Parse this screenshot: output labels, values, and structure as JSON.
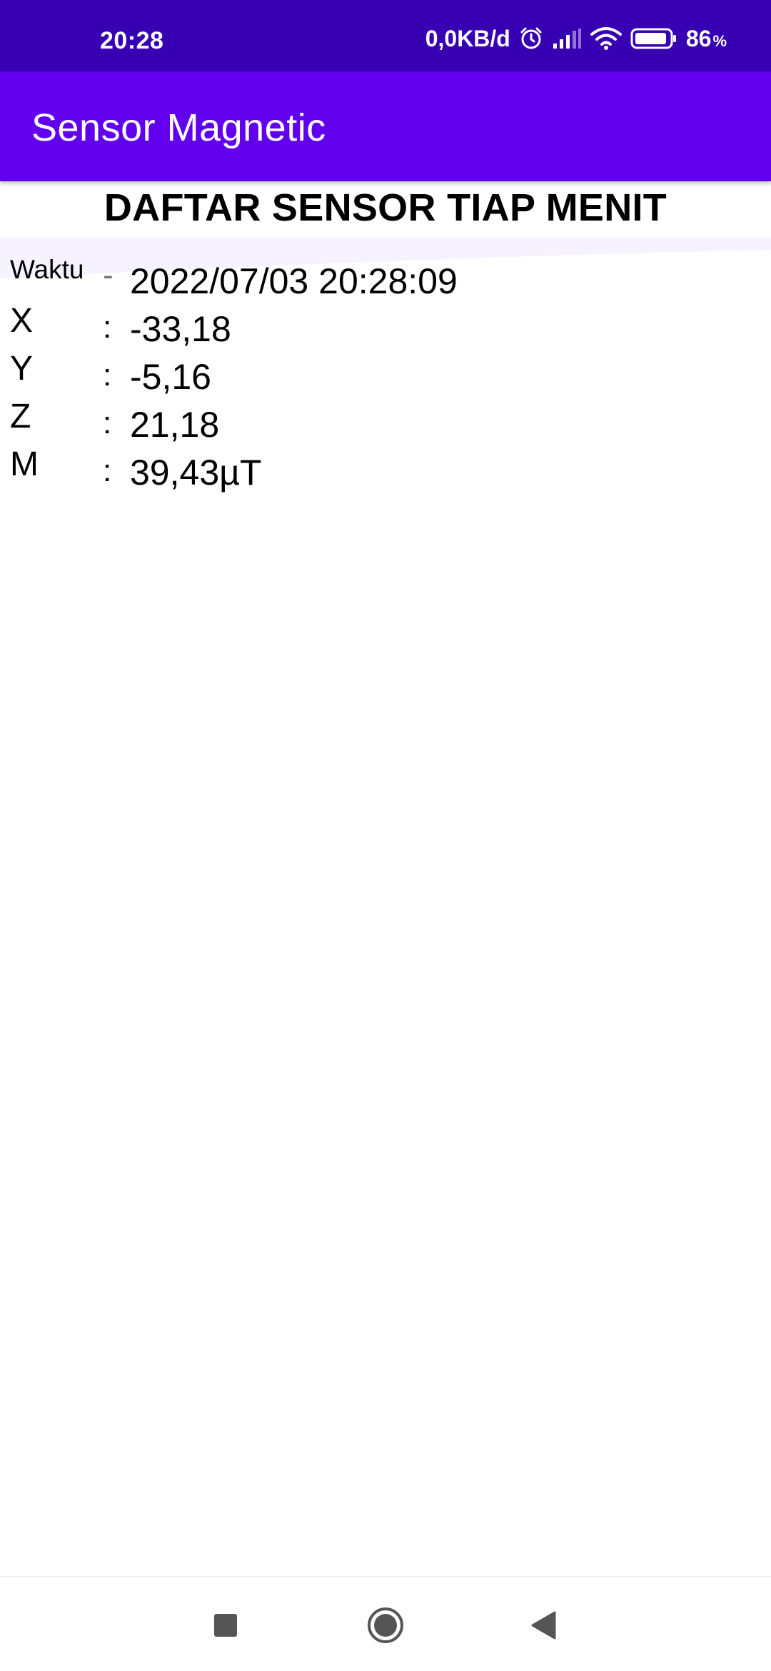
{
  "status_bar": {
    "time": "20:28",
    "network_speed": "0,0KB/d",
    "battery_percent": "86",
    "battery_suffix": "%",
    "icons": [
      "alarm-icon",
      "signal-icon",
      "wifi-icon",
      "battery-icon"
    ]
  },
  "app_bar": {
    "title": "Sensor Magnetic",
    "color": "#6200ee",
    "status_color": "#3700b3"
  },
  "content": {
    "heading": "DAFTAR SENSOR TIAP MENIT",
    "rows": [
      {
        "label": "Waktu",
        "separator": "-",
        "value": "2022/07/03 20:28:09"
      },
      {
        "label": "X",
        "separator": ":",
        "value": "-33,18"
      },
      {
        "label": "Y",
        "separator": ":",
        "value": "-5,16"
      },
      {
        "label": "Z",
        "separator": ":",
        "value": "21,18"
      },
      {
        "label": "M",
        "separator": ":",
        "value": "39,43µT"
      }
    ]
  },
  "nav_bar": {
    "buttons": [
      "recents-icon",
      "home-icon",
      "back-icon"
    ]
  }
}
